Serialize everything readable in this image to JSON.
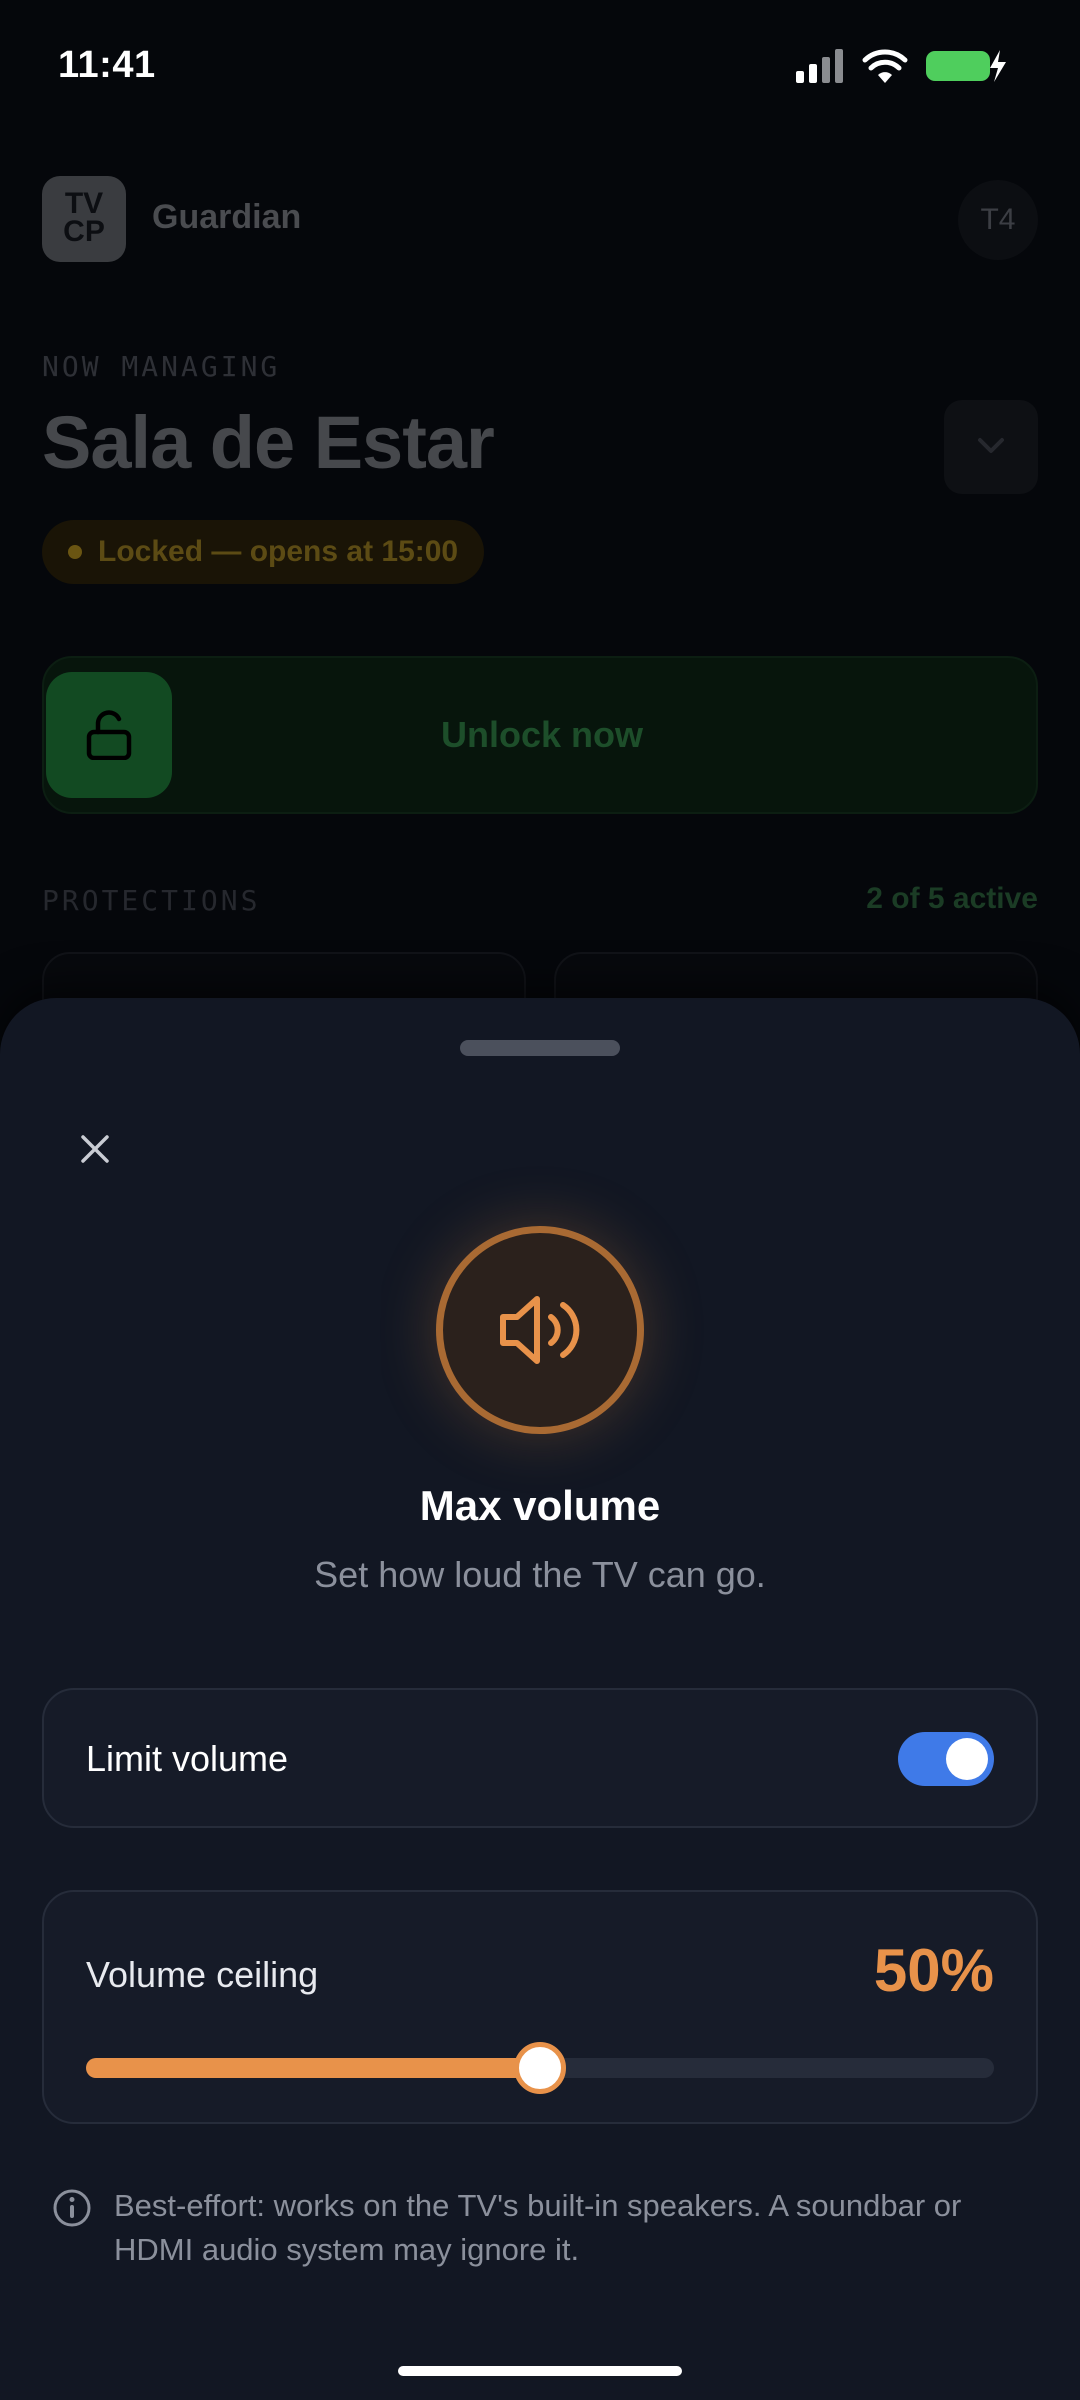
{
  "status_bar": {
    "time": "11:41",
    "battery_color": "#4fce5d"
  },
  "app": {
    "logo_text_line1": "TV",
    "logo_text_line2": "CP",
    "name": "Guardian",
    "avatar_initials": "T4"
  },
  "room": {
    "eyebrow": "NOW MANAGING",
    "title": "Sala de Estar",
    "lock_status": "Locked — opens at 15:00"
  },
  "unlock": {
    "label": "Unlock now"
  },
  "protections": {
    "heading": "PROTECTIONS",
    "active_count": "2 of 5 active"
  },
  "sheet": {
    "title": "Max volume",
    "subtitle": "Set how loud the TV can go.",
    "icon": "speaker-icon",
    "accent_color": "#e8924a",
    "limit_toggle": {
      "label": "Limit volume",
      "on": true
    },
    "ceiling": {
      "label": "Volume ceiling",
      "value_text": "50%",
      "value": 0.5
    },
    "info_text": "Best-effort: works on the TV's built-in speakers. A soundbar or HDMI audio system may ignore it."
  }
}
